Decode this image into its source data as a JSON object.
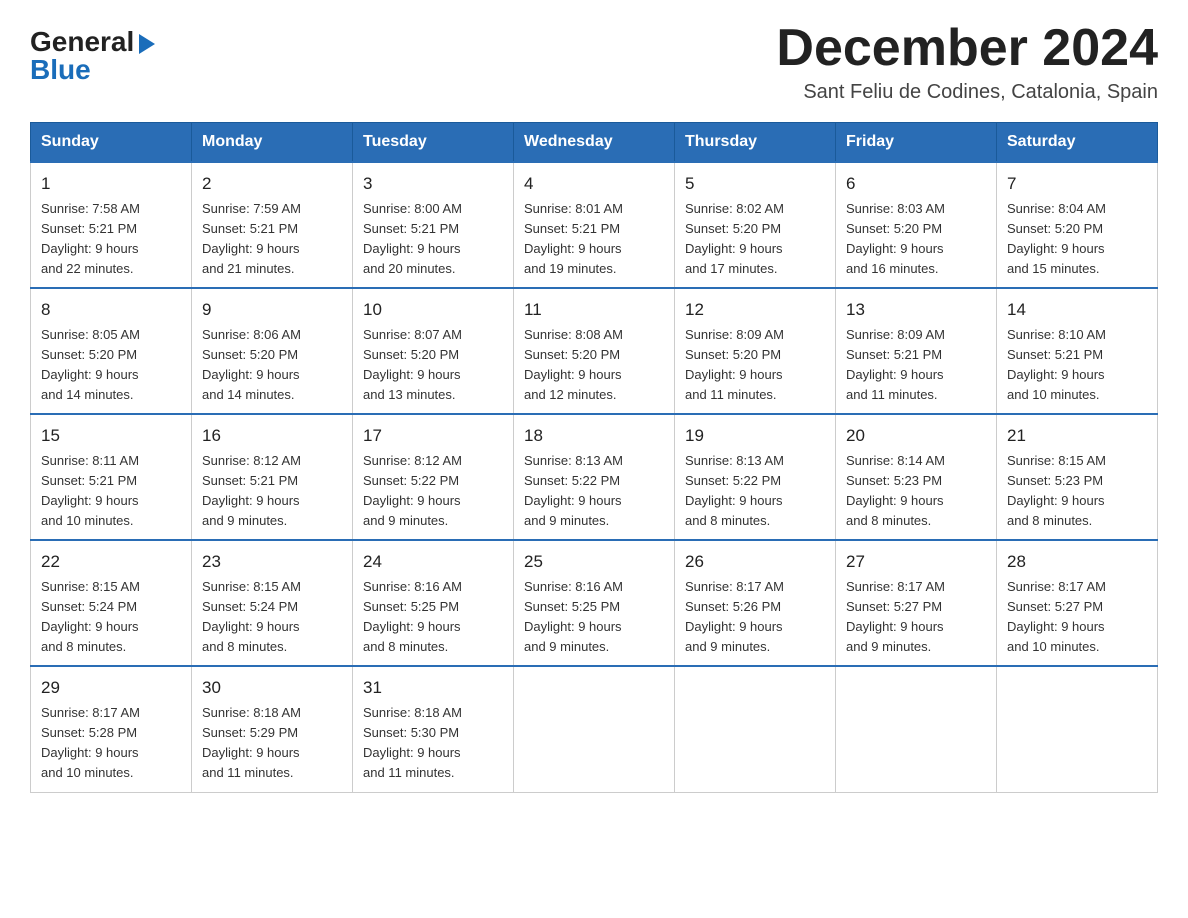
{
  "header": {
    "logo_general": "General",
    "logo_blue": "Blue",
    "month_title": "December 2024",
    "location": "Sant Feliu de Codines, Catalonia, Spain"
  },
  "weekdays": [
    "Sunday",
    "Monday",
    "Tuesday",
    "Wednesday",
    "Thursday",
    "Friday",
    "Saturday"
  ],
  "weeks": [
    [
      {
        "day": "1",
        "sunrise": "7:58 AM",
        "sunset": "5:21 PM",
        "daylight": "9 hours and 22 minutes."
      },
      {
        "day": "2",
        "sunrise": "7:59 AM",
        "sunset": "5:21 PM",
        "daylight": "9 hours and 21 minutes."
      },
      {
        "day": "3",
        "sunrise": "8:00 AM",
        "sunset": "5:21 PM",
        "daylight": "9 hours and 20 minutes."
      },
      {
        "day": "4",
        "sunrise": "8:01 AM",
        "sunset": "5:21 PM",
        "daylight": "9 hours and 19 minutes."
      },
      {
        "day": "5",
        "sunrise": "8:02 AM",
        "sunset": "5:20 PM",
        "daylight": "9 hours and 17 minutes."
      },
      {
        "day": "6",
        "sunrise": "8:03 AM",
        "sunset": "5:20 PM",
        "daylight": "9 hours and 16 minutes."
      },
      {
        "day": "7",
        "sunrise": "8:04 AM",
        "sunset": "5:20 PM",
        "daylight": "9 hours and 15 minutes."
      }
    ],
    [
      {
        "day": "8",
        "sunrise": "8:05 AM",
        "sunset": "5:20 PM",
        "daylight": "9 hours and 14 minutes."
      },
      {
        "day": "9",
        "sunrise": "8:06 AM",
        "sunset": "5:20 PM",
        "daylight": "9 hours and 14 minutes."
      },
      {
        "day": "10",
        "sunrise": "8:07 AM",
        "sunset": "5:20 PM",
        "daylight": "9 hours and 13 minutes."
      },
      {
        "day": "11",
        "sunrise": "8:08 AM",
        "sunset": "5:20 PM",
        "daylight": "9 hours and 12 minutes."
      },
      {
        "day": "12",
        "sunrise": "8:09 AM",
        "sunset": "5:20 PM",
        "daylight": "9 hours and 11 minutes."
      },
      {
        "day": "13",
        "sunrise": "8:09 AM",
        "sunset": "5:21 PM",
        "daylight": "9 hours and 11 minutes."
      },
      {
        "day": "14",
        "sunrise": "8:10 AM",
        "sunset": "5:21 PM",
        "daylight": "9 hours and 10 minutes."
      }
    ],
    [
      {
        "day": "15",
        "sunrise": "8:11 AM",
        "sunset": "5:21 PM",
        "daylight": "9 hours and 10 minutes."
      },
      {
        "day": "16",
        "sunrise": "8:12 AM",
        "sunset": "5:21 PM",
        "daylight": "9 hours and 9 minutes."
      },
      {
        "day": "17",
        "sunrise": "8:12 AM",
        "sunset": "5:22 PM",
        "daylight": "9 hours and 9 minutes."
      },
      {
        "day": "18",
        "sunrise": "8:13 AM",
        "sunset": "5:22 PM",
        "daylight": "9 hours and 9 minutes."
      },
      {
        "day": "19",
        "sunrise": "8:13 AM",
        "sunset": "5:22 PM",
        "daylight": "9 hours and 8 minutes."
      },
      {
        "day": "20",
        "sunrise": "8:14 AM",
        "sunset": "5:23 PM",
        "daylight": "9 hours and 8 minutes."
      },
      {
        "day": "21",
        "sunrise": "8:15 AM",
        "sunset": "5:23 PM",
        "daylight": "9 hours and 8 minutes."
      }
    ],
    [
      {
        "day": "22",
        "sunrise": "8:15 AM",
        "sunset": "5:24 PM",
        "daylight": "9 hours and 8 minutes."
      },
      {
        "day": "23",
        "sunrise": "8:15 AM",
        "sunset": "5:24 PM",
        "daylight": "9 hours and 8 minutes."
      },
      {
        "day": "24",
        "sunrise": "8:16 AM",
        "sunset": "5:25 PM",
        "daylight": "9 hours and 8 minutes."
      },
      {
        "day": "25",
        "sunrise": "8:16 AM",
        "sunset": "5:25 PM",
        "daylight": "9 hours and 9 minutes."
      },
      {
        "day": "26",
        "sunrise": "8:17 AM",
        "sunset": "5:26 PM",
        "daylight": "9 hours and 9 minutes."
      },
      {
        "day": "27",
        "sunrise": "8:17 AM",
        "sunset": "5:27 PM",
        "daylight": "9 hours and 9 minutes."
      },
      {
        "day": "28",
        "sunrise": "8:17 AM",
        "sunset": "5:27 PM",
        "daylight": "9 hours and 10 minutes."
      }
    ],
    [
      {
        "day": "29",
        "sunrise": "8:17 AM",
        "sunset": "5:28 PM",
        "daylight": "9 hours and 10 minutes."
      },
      {
        "day": "30",
        "sunrise": "8:18 AM",
        "sunset": "5:29 PM",
        "daylight": "9 hours and 11 minutes."
      },
      {
        "day": "31",
        "sunrise": "8:18 AM",
        "sunset": "5:30 PM",
        "daylight": "9 hours and 11 minutes."
      },
      null,
      null,
      null,
      null
    ]
  ]
}
